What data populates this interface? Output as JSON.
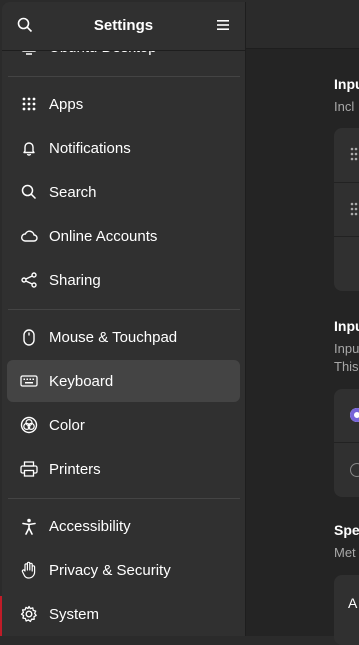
{
  "sidebar": {
    "title": "Settings",
    "items": [
      {
        "label": "Ubuntu Desktop",
        "icon": "ubuntu-desktop-icon"
      },
      {
        "label": "Apps",
        "icon": "apps-grid-icon"
      },
      {
        "label": "Notifications",
        "icon": "bell-icon"
      },
      {
        "label": "Search",
        "icon": "search-icon"
      },
      {
        "label": "Online Accounts",
        "icon": "cloud-icon"
      },
      {
        "label": "Sharing",
        "icon": "share-icon"
      },
      {
        "label": "Mouse & Touchpad",
        "icon": "mouse-icon"
      },
      {
        "label": "Keyboard",
        "icon": "keyboard-icon"
      },
      {
        "label": "Color",
        "icon": "color-icon"
      },
      {
        "label": "Printers",
        "icon": "printer-icon"
      },
      {
        "label": "Accessibility",
        "icon": "accessibility-icon"
      },
      {
        "label": "Privacy & Security",
        "icon": "hand-icon"
      },
      {
        "label": "System",
        "icon": "gear-icon"
      }
    ],
    "selected": "Keyboard"
  },
  "main": {
    "section1": {
      "title": "Inpu",
      "subtitle": "Incl"
    },
    "section2": {
      "title": "Inpu",
      "subtitle1": "Inpu",
      "subtitle2": "This"
    },
    "section3": {
      "title": "Spe",
      "subtitle": "Met",
      "row_text": "A"
    }
  },
  "colors": {
    "accent": "#7764d8",
    "selected_bg": "#444444",
    "sidebar_bg": "#303030"
  }
}
